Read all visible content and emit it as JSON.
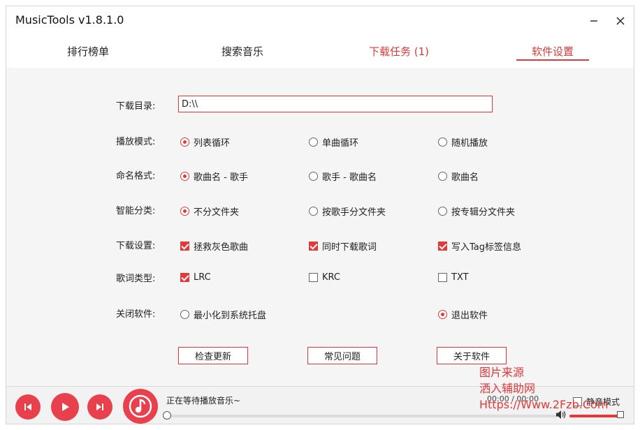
{
  "app": {
    "title": "MusicTools v1.8.1.0"
  },
  "colors": {
    "accent": "#e63838",
    "player_button": "#e8414d"
  },
  "tabs": [
    {
      "label": "排行榜单"
    },
    {
      "label": "搜索音乐"
    },
    {
      "label": "下载任务 (1)"
    },
    {
      "label": "软件设置"
    }
  ],
  "settings": {
    "download_dir": {
      "label": "下载目录:",
      "value": "D:\\\\"
    },
    "play_mode": {
      "label": "播放模式:",
      "options": [
        "列表循环",
        "单曲循环",
        "随机播放"
      ],
      "selected": "列表循环"
    },
    "naming": {
      "label": "命名格式:",
      "options": [
        "歌曲名 - 歌手",
        "歌手 - 歌曲名",
        "歌曲名"
      ],
      "selected": "歌曲名 - 歌手"
    },
    "smart_sort": {
      "label": "智能分类:",
      "options": [
        "不分文件夹",
        "按歌手分文件夹",
        "按专辑分文件夹"
      ],
      "selected": "不分文件夹"
    },
    "download_settings": {
      "label": "下载设置:",
      "options": [
        "拯救灰色歌曲",
        "同时下载歌词",
        "写入Tag标签信息"
      ],
      "checked": [
        true,
        true,
        true
      ]
    },
    "lyric_type": {
      "label": "歌词类型:",
      "options": [
        "LRC",
        "KRC",
        "TXT"
      ],
      "checked": [
        true,
        false,
        false
      ]
    },
    "close_app": {
      "label": "关闭软件:",
      "options": [
        "最小化到系统托盘",
        "退出软件"
      ],
      "selected": "退出软件"
    },
    "buttons": [
      "检查更新",
      "常见问题",
      "关于软件"
    ]
  },
  "player": {
    "status": "正在等待播放音乐~",
    "time": "00:00 / 00:00",
    "mute_label": "静音模式",
    "mute_checked": false,
    "progress": 0
  },
  "watermark": {
    "lines": [
      "图片来源",
      "洒入辅助网",
      "Https://Www.2Fzb.Com"
    ]
  }
}
